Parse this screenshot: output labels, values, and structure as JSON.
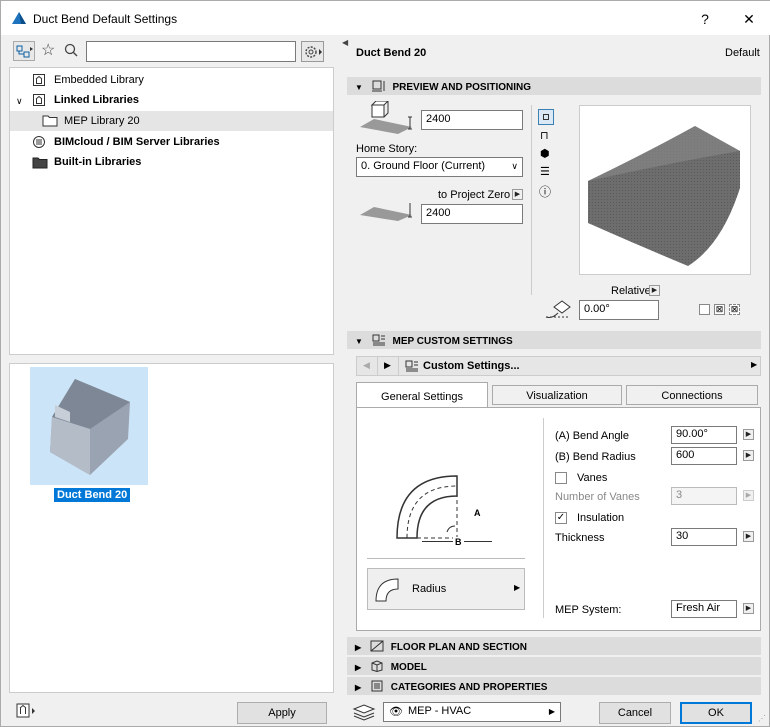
{
  "window": {
    "title": "Duct Bend Default Settings",
    "help": "?",
    "close": "✕"
  },
  "library": {
    "search_value": "",
    "items": [
      {
        "label": "Embedded Library"
      },
      {
        "label": "Linked Libraries"
      },
      {
        "label": "MEP Library 20"
      },
      {
        "label": "BIMcloud / BIM Server Libraries"
      },
      {
        "label": "Built-in Libraries"
      }
    ],
    "selected_object": "Duct Bend 20"
  },
  "header": {
    "object_name": "Duct Bend 20",
    "default_label": "Default"
  },
  "preview": {
    "section_title": "PREVIEW AND POSITIONING",
    "height_value": "2400",
    "home_story_label": "Home Story:",
    "home_story_value": "0. Ground Floor (Current)",
    "to_project_zero": "to Project Zero",
    "elevation_value": "2400",
    "relative_label": "Relative",
    "angle_value": "0.00°"
  },
  "custom": {
    "section_title": "MEP CUSTOM SETTINGS",
    "page_label": "Custom Settings...",
    "tabs": [
      {
        "label": "General Settings"
      },
      {
        "label": "Visualization"
      },
      {
        "label": "Connections"
      }
    ],
    "bend_angle_label": "(A) Bend Angle",
    "bend_angle_value": "90.00°",
    "bend_radius_label": "(B) Bend Radius",
    "bend_radius_value": "600",
    "vanes_label": "Vanes",
    "vanes_checked": false,
    "num_vanes_label": "Number of Vanes",
    "num_vanes_value": "3",
    "insulation_label": "Insulation",
    "insulation_checked": true,
    "thickness_label": "Thickness",
    "thickness_value": "30",
    "diagram_a": "A",
    "diagram_b": "B",
    "type_button_label": "Radius",
    "mep_system_label": "MEP System:",
    "mep_system_value": "Fresh Air"
  },
  "sections": [
    {
      "label": "FLOOR PLAN AND SECTION"
    },
    {
      "label": "MODEL"
    },
    {
      "label": "CATEGORIES AND PROPERTIES"
    }
  ],
  "footer": {
    "apply": "Apply",
    "layer_value": "MEP - HVAC",
    "cancel": "Cancel",
    "ok": "OK"
  },
  "colors": {
    "selection": "#cce4f7",
    "selected_label": "#0078d7",
    "accent": "#005a9e"
  }
}
